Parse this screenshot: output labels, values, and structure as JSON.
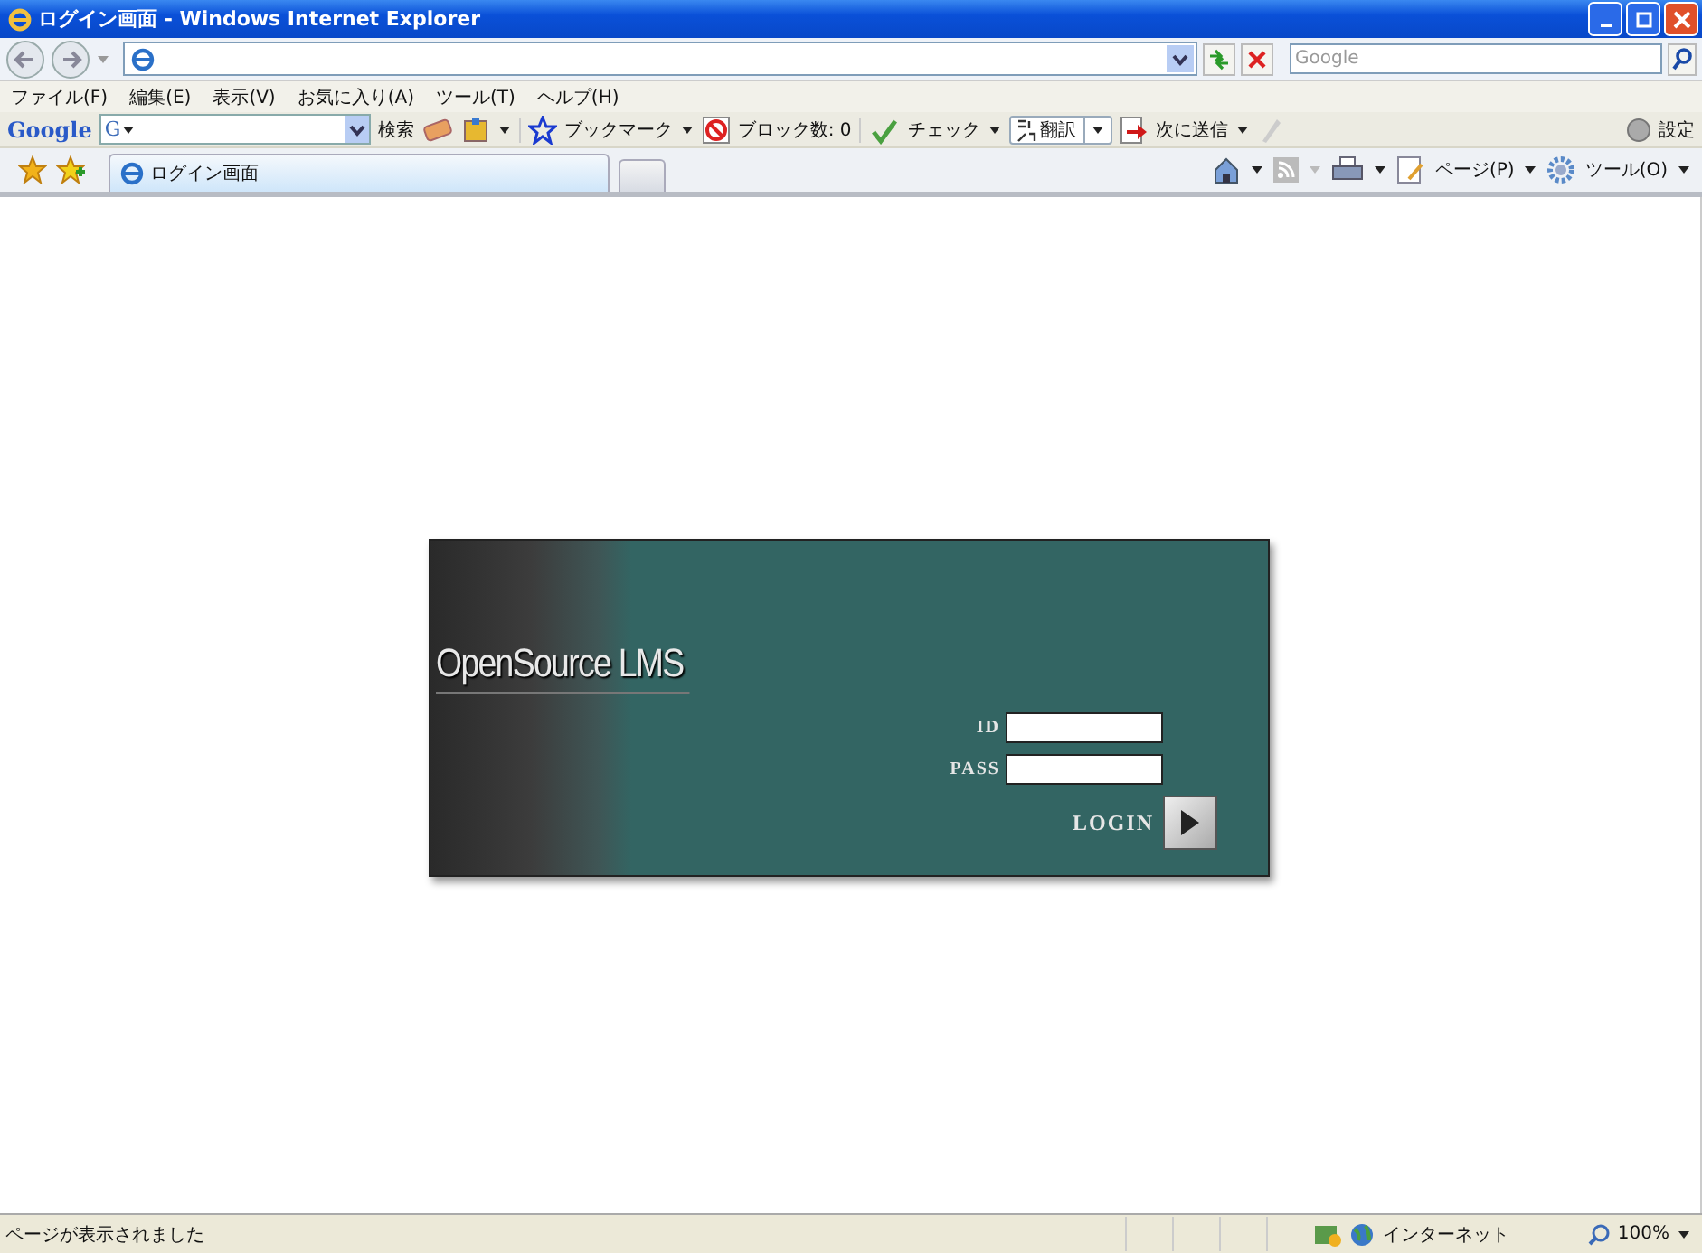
{
  "window": {
    "title": "ログイン画面 - Windows Internet Explorer"
  },
  "address_bar": {
    "search_placeholder": "Google"
  },
  "menu": [
    "ファイル(F)",
    "編集(E)",
    "表示(V)",
    "お気に入り(A)",
    "ツール(T)",
    "ヘルプ(H)"
  ],
  "google_toolbar": {
    "logo": "Google",
    "engine": "G",
    "search": "検索",
    "bookmarks": "ブックマーク",
    "blocked": "ブロック数: 0",
    "check": "チェック",
    "translate": "翻訳",
    "send": "次に送信",
    "settings": "設定"
  },
  "tabs": [
    {
      "label": "ログイン画面",
      "selected": true
    }
  ],
  "command_bar": {
    "page": "ページ(P)",
    "tools": "ツール(O)"
  },
  "login": {
    "logo": "OpenSource LMS",
    "fields": [
      {
        "label": "ID"
      },
      {
        "label": "PASS"
      }
    ],
    "button": "LOGIN"
  },
  "status_bar": {
    "message": "ページが表示されました",
    "zone": "インターネット",
    "zoom": "100%"
  }
}
